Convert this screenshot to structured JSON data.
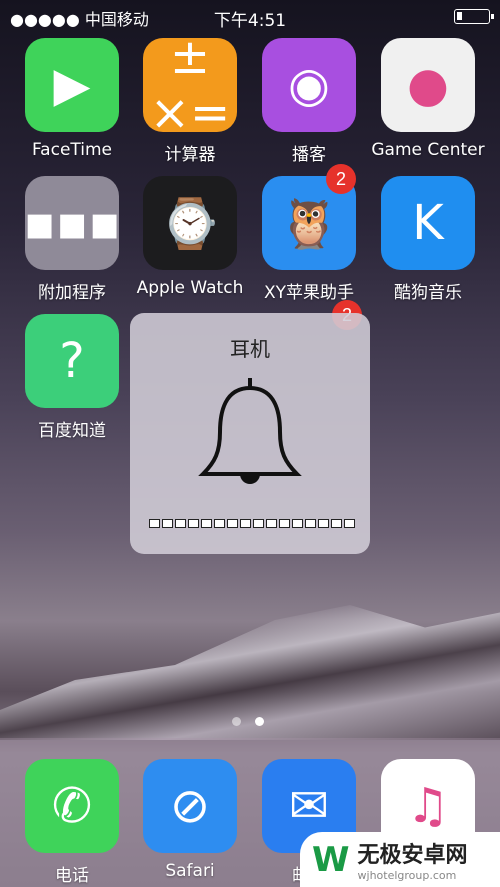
{
  "status": {
    "carrier": "●●●●● 中国移动",
    "time": "下午4:51",
    "battery_percent": 15
  },
  "apps": [
    {
      "label": "FaceTime",
      "icon": "facetime-icon",
      "color": "#3fd35a",
      "glyph": "▶"
    },
    {
      "label": "计算器",
      "icon": "calculator-icon",
      "color": "#f39a1c",
      "glyph": "± ×="
    },
    {
      "label": "播客",
      "icon": "podcasts-icon",
      "color": "#a84fe0",
      "glyph": "◉"
    },
    {
      "label": "Game Center",
      "icon": "game-center-icon",
      "color": "#f0f0f0",
      "glyph": "●"
    },
    {
      "label": "附加程序",
      "icon": "folder-icon",
      "color": "#8f8a98",
      "glyph": "▪▪▪"
    },
    {
      "label": "Apple Watch",
      "icon": "apple-watch-icon",
      "color": "#1c1c1e",
      "glyph": "⌚"
    },
    {
      "label": "XY苹果助手",
      "icon": "xy-assistant-icon",
      "color": "#2a8ef0",
      "glyph": "🦉",
      "badge": "2"
    },
    {
      "label": "酷狗音乐",
      "icon": "kugou-icon",
      "color": "#1f8ef0",
      "glyph": "K"
    },
    {
      "label": "百度知道",
      "icon": "baidu-zhidao-icon",
      "color": "#3ccf7a",
      "glyph": "?"
    }
  ],
  "hidden_badge": "2",
  "hud": {
    "title": "耳机",
    "icon": "bell-icon",
    "volume_level": 0,
    "segments": 16
  },
  "page_dots": {
    "count": 2,
    "current": 2
  },
  "dock": [
    {
      "label": "电话",
      "icon": "phone-icon",
      "color": "#3fd35a",
      "glyph": "✆"
    },
    {
      "label": "Safari",
      "icon": "safari-icon",
      "color": "#2e8df0",
      "glyph": "⊘"
    },
    {
      "label": "邮件",
      "icon": "mail-icon",
      "color": "#2a7ef0",
      "glyph": "✉"
    },
    {
      "label": "音乐",
      "icon": "music-icon",
      "color": "#ffffff",
      "glyph": "♫"
    }
  ],
  "watermark": {
    "name": "无极安卓网",
    "url": "wjhotelgroup.com"
  }
}
